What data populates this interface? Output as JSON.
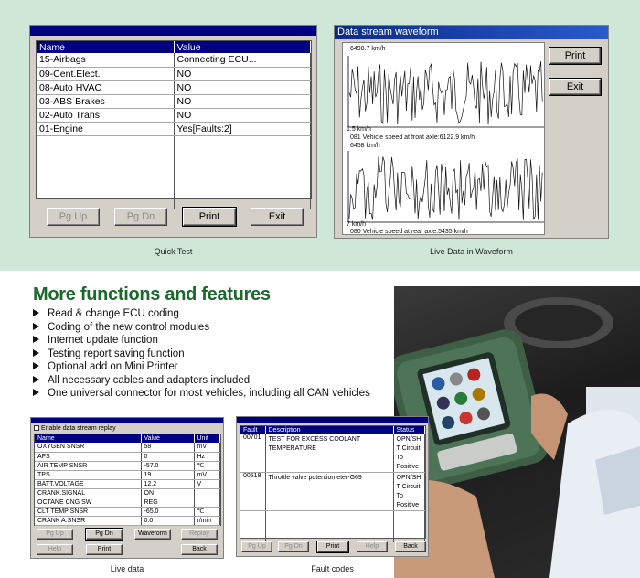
{
  "quick_test": {
    "headers": [
      "Name",
      "Value"
    ],
    "rows": [
      {
        "name": "15-Airbags",
        "value": "Connecting ECU..."
      },
      {
        "name": "09-Cent.Elect.",
        "value": "NO"
      },
      {
        "name": "08-Auto HVAC",
        "value": "NO"
      },
      {
        "name": "03-ABS Brakes",
        "value": "NO"
      },
      {
        "name": "02-Auto Trans",
        "value": "NO"
      },
      {
        "name": "01-Engine",
        "value": "Yes[Faults:2]"
      }
    ],
    "buttons": {
      "pg_up": "Pg Up",
      "pg_dn": "Pg Dn",
      "print": "Print",
      "exit": "Exit"
    },
    "caption": "Quick Test"
  },
  "waveform": {
    "title": "Data stream waveform",
    "top": {
      "max": "6498.7 km/h",
      "min": "1.5 km/h",
      "label": "081 Vehicle speed at front axle:6122.9 km/h"
    },
    "bottom": {
      "max": "6458 km/h",
      "min": "7 km/h",
      "label": "080 Vehicle speed at rear axle:5435 km/h"
    },
    "buttons": {
      "print": "Print",
      "exit": "Exit"
    },
    "caption": "Live Data in Waveform"
  },
  "features": {
    "heading": "More functions and features",
    "items": [
      "Read & change ECU coding",
      "Coding of the new control modules",
      "Internet update function",
      "Testing report saving function",
      "Optional add on Mini Printer",
      "All necessary cables and adapters included",
      "One universal connector for most vehicles, including all CAN vehicles"
    ]
  },
  "live_data": {
    "checkbox_label": "Enable data stream replay",
    "headers": [
      "Name",
      "Value",
      "Unit"
    ],
    "rows": [
      {
        "name": "OXYGEN SNSR",
        "value": "58",
        "unit": "mV"
      },
      {
        "name": "AFS",
        "value": "0",
        "unit": "Hz"
      },
      {
        "name": "AIR TEMP SNSR",
        "value": "-57.0",
        "unit": "℃"
      },
      {
        "name": "TPS",
        "value": "19",
        "unit": "mV"
      },
      {
        "name": "BATT.VOLTAGE",
        "value": "12.2",
        "unit": "V"
      },
      {
        "name": "CRANK.SIGNAL",
        "value": "ON",
        "unit": ""
      },
      {
        "name": "OCTANE CNG SW",
        "value": "REG",
        "unit": ""
      },
      {
        "name": "CLT TEMP SNSR",
        "value": "-65.0",
        "unit": "℃"
      },
      {
        "name": "CRANK A.SNSR",
        "value": "0.0",
        "unit": "r/min"
      }
    ],
    "buttons": {
      "pg_up": "Pg Up",
      "pg_dn": "Pg Dn",
      "waveform": "Waveform",
      "replay": "Replay",
      "help": "Help",
      "print": "Print",
      "back": "Back"
    },
    "caption": "Live data"
  },
  "fault_codes": {
    "headers": [
      "Fault",
      "Description",
      "Status"
    ],
    "rows": [
      {
        "fault": "00701",
        "description": "TEST FOR EXCESS COOLANT TEMPERATURE",
        "status": "OPN/SH T Circuit To Positive"
      },
      {
        "fault": "00518",
        "description": "Throttle valve potentiometer-G69",
        "status": "OPN/SH T Circuit To Positive"
      }
    ],
    "buttons": {
      "pg_up": "Pg Up",
      "pg_dn": "Pg Dn",
      "print": "Print",
      "help": "Help",
      "back": "Back"
    },
    "caption": "Fault codes"
  },
  "colors": {
    "band": "#cfe7d6",
    "heading": "#1a6a2a",
    "header_blue": "#000080"
  }
}
